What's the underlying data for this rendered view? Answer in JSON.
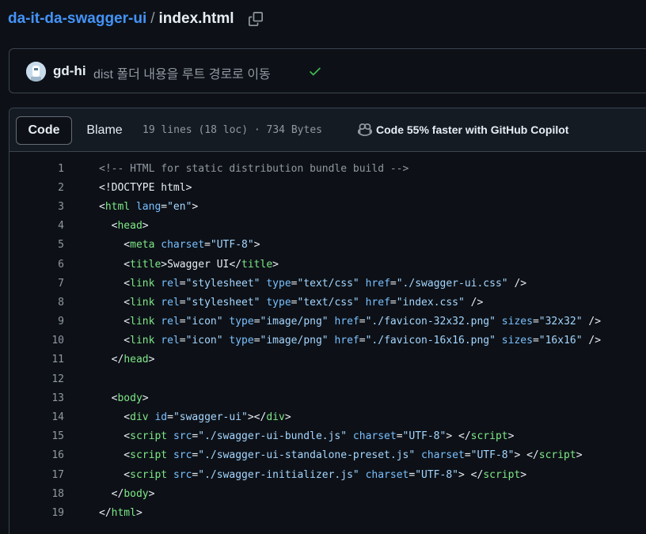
{
  "breadcrumb": {
    "repo": "da-it-da-swagger-ui",
    "separator": "/",
    "file": "index.html"
  },
  "commit": {
    "author": "gd-hi",
    "message": "dist 폴더 내용을 루트 경로로 이동",
    "status_icon": "check-icon"
  },
  "file_header": {
    "tab_code": "Code",
    "tab_blame": "Blame",
    "file_info": "19 lines (18 loc) · 734 Bytes",
    "copilot_text": "Code 55% faster with GitHub Copilot"
  },
  "colors": {
    "tag": "#7ee787",
    "attr": "#79c0ff",
    "string": "#a5d6ff",
    "comment": "#9198a1",
    "link": "#4493f8",
    "check": "#3fb950"
  },
  "code_lines": [
    [
      [
        "c",
        "<!-- HTML for static distribution bundle build -->"
      ]
    ],
    [
      [
        "p",
        "<!DOCTYPE html>"
      ]
    ],
    [
      [
        "p",
        "<"
      ],
      [
        "g",
        "html"
      ],
      [
        "p",
        " "
      ],
      [
        "a",
        "lang"
      ],
      [
        "p",
        "="
      ],
      [
        "s",
        "\"en\""
      ],
      [
        "p",
        ">"
      ]
    ],
    [
      [
        "p",
        "  <"
      ],
      [
        "g",
        "head"
      ],
      [
        "p",
        ">"
      ]
    ],
    [
      [
        "p",
        "    <"
      ],
      [
        "g",
        "meta"
      ],
      [
        "p",
        " "
      ],
      [
        "a",
        "charset"
      ],
      [
        "p",
        "="
      ],
      [
        "s",
        "\"UTF-8\""
      ],
      [
        "p",
        ">"
      ]
    ],
    [
      [
        "p",
        "    <"
      ],
      [
        "g",
        "title"
      ],
      [
        "p",
        ">Swagger UI</"
      ],
      [
        "g",
        "title"
      ],
      [
        "p",
        ">"
      ]
    ],
    [
      [
        "p",
        "    <"
      ],
      [
        "g",
        "link"
      ],
      [
        "p",
        " "
      ],
      [
        "a",
        "rel"
      ],
      [
        "p",
        "="
      ],
      [
        "s",
        "\"stylesheet\""
      ],
      [
        "p",
        " "
      ],
      [
        "a",
        "type"
      ],
      [
        "p",
        "="
      ],
      [
        "s",
        "\"text/css\""
      ],
      [
        "p",
        " "
      ],
      [
        "a",
        "href"
      ],
      [
        "p",
        "="
      ],
      [
        "s",
        "\"./swagger-ui.css\""
      ],
      [
        "p",
        " />"
      ]
    ],
    [
      [
        "p",
        "    <"
      ],
      [
        "g",
        "link"
      ],
      [
        "p",
        " "
      ],
      [
        "a",
        "rel"
      ],
      [
        "p",
        "="
      ],
      [
        "s",
        "\"stylesheet\""
      ],
      [
        "p",
        " "
      ],
      [
        "a",
        "type"
      ],
      [
        "p",
        "="
      ],
      [
        "s",
        "\"text/css\""
      ],
      [
        "p",
        " "
      ],
      [
        "a",
        "href"
      ],
      [
        "p",
        "="
      ],
      [
        "s",
        "\"index.css\""
      ],
      [
        "p",
        " />"
      ]
    ],
    [
      [
        "p",
        "    <"
      ],
      [
        "g",
        "link"
      ],
      [
        "p",
        " "
      ],
      [
        "a",
        "rel"
      ],
      [
        "p",
        "="
      ],
      [
        "s",
        "\"icon\""
      ],
      [
        "p",
        " "
      ],
      [
        "a",
        "type"
      ],
      [
        "p",
        "="
      ],
      [
        "s",
        "\"image/png\""
      ],
      [
        "p",
        " "
      ],
      [
        "a",
        "href"
      ],
      [
        "p",
        "="
      ],
      [
        "s",
        "\"./favicon-32x32.png\""
      ],
      [
        "p",
        " "
      ],
      [
        "a",
        "sizes"
      ],
      [
        "p",
        "="
      ],
      [
        "s",
        "\"32x32\""
      ],
      [
        "p",
        " />"
      ]
    ],
    [
      [
        "p",
        "    <"
      ],
      [
        "g",
        "link"
      ],
      [
        "p",
        " "
      ],
      [
        "a",
        "rel"
      ],
      [
        "p",
        "="
      ],
      [
        "s",
        "\"icon\""
      ],
      [
        "p",
        " "
      ],
      [
        "a",
        "type"
      ],
      [
        "p",
        "="
      ],
      [
        "s",
        "\"image/png\""
      ],
      [
        "p",
        " "
      ],
      [
        "a",
        "href"
      ],
      [
        "p",
        "="
      ],
      [
        "s",
        "\"./favicon-16x16.png\""
      ],
      [
        "p",
        " "
      ],
      [
        "a",
        "sizes"
      ],
      [
        "p",
        "="
      ],
      [
        "s",
        "\"16x16\""
      ],
      [
        "p",
        " />"
      ]
    ],
    [
      [
        "p",
        "  </"
      ],
      [
        "g",
        "head"
      ],
      [
        "p",
        ">"
      ]
    ],
    [],
    [
      [
        "p",
        "  <"
      ],
      [
        "g",
        "body"
      ],
      [
        "p",
        ">"
      ]
    ],
    [
      [
        "p",
        "    <"
      ],
      [
        "g",
        "div"
      ],
      [
        "p",
        " "
      ],
      [
        "a",
        "id"
      ],
      [
        "p",
        "="
      ],
      [
        "s",
        "\"swagger-ui\""
      ],
      [
        "p",
        "></"
      ],
      [
        "g",
        "div"
      ],
      [
        "p",
        ">"
      ]
    ],
    [
      [
        "p",
        "    <"
      ],
      [
        "g",
        "script"
      ],
      [
        "p",
        " "
      ],
      [
        "a",
        "src"
      ],
      [
        "p",
        "="
      ],
      [
        "s",
        "\"./swagger-ui-bundle.js\""
      ],
      [
        "p",
        " "
      ],
      [
        "a",
        "charset"
      ],
      [
        "p",
        "="
      ],
      [
        "s",
        "\"UTF-8\""
      ],
      [
        "p",
        "> </"
      ],
      [
        "g",
        "script"
      ],
      [
        "p",
        ">"
      ]
    ],
    [
      [
        "p",
        "    <"
      ],
      [
        "g",
        "script"
      ],
      [
        "p",
        " "
      ],
      [
        "a",
        "src"
      ],
      [
        "p",
        "="
      ],
      [
        "s",
        "\"./swagger-ui-standalone-preset.js\""
      ],
      [
        "p",
        " "
      ],
      [
        "a",
        "charset"
      ],
      [
        "p",
        "="
      ],
      [
        "s",
        "\"UTF-8\""
      ],
      [
        "p",
        "> </"
      ],
      [
        "g",
        "script"
      ],
      [
        "p",
        ">"
      ]
    ],
    [
      [
        "p",
        "    <"
      ],
      [
        "g",
        "script"
      ],
      [
        "p",
        " "
      ],
      [
        "a",
        "src"
      ],
      [
        "p",
        "="
      ],
      [
        "s",
        "\"./swagger-initializer.js\""
      ],
      [
        "p",
        " "
      ],
      [
        "a",
        "charset"
      ],
      [
        "p",
        "="
      ],
      [
        "s",
        "\"UTF-8\""
      ],
      [
        "p",
        "> </"
      ],
      [
        "g",
        "script"
      ],
      [
        "p",
        ">"
      ]
    ],
    [
      [
        "p",
        "  </"
      ],
      [
        "g",
        "body"
      ],
      [
        "p",
        ">"
      ]
    ],
    [
      [
        "p",
        "</"
      ],
      [
        "g",
        "html"
      ],
      [
        "p",
        ">"
      ]
    ]
  ]
}
